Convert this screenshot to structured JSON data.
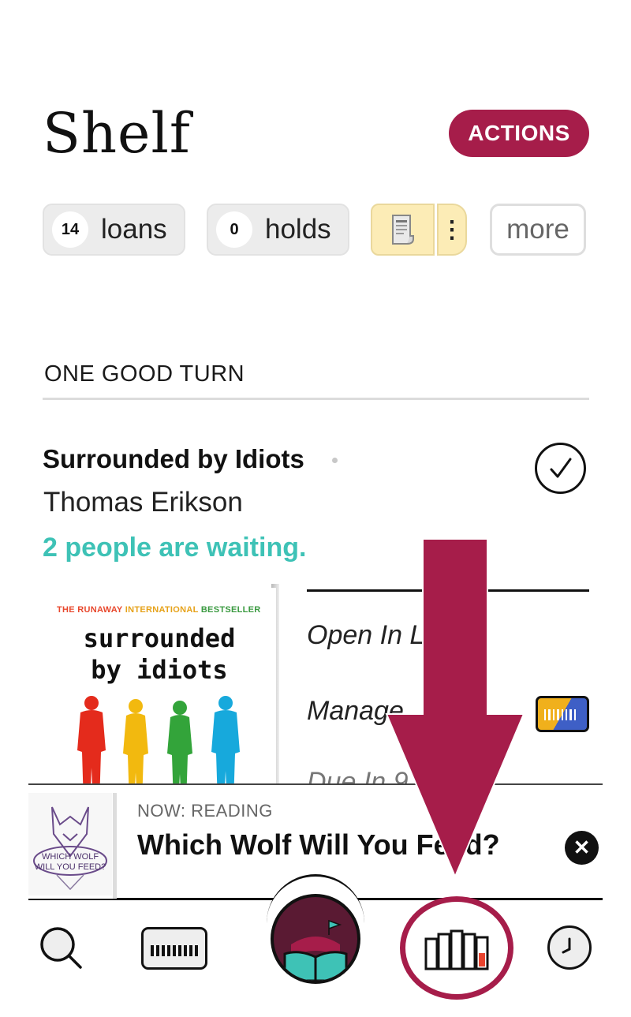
{
  "colors": {
    "accent": "#a61d4a",
    "teal": "#3ec2b6"
  },
  "header": {
    "title": "Shelf",
    "actions_label": "ACTIONS"
  },
  "chips": {
    "loans": {
      "count": "14",
      "label": "loans"
    },
    "holds": {
      "count": "0",
      "label": "holds"
    },
    "tag_icon": "receipt-icon",
    "more_label": "more"
  },
  "section": {
    "heading": "ONE GOOD TURN"
  },
  "book": {
    "title": "Surrounded by Idiots",
    "author": "Thomas Erikson",
    "status": "2 people are waiting.",
    "cover": {
      "tagline_1": "THE RUNAWAY",
      "tagline_2": "INTERNATIONAL",
      "tagline_3": "BESTSELLER",
      "title_line_1": "surrounded",
      "title_line_2": "by idiots"
    }
  },
  "book_menu": {
    "open_label": "Open In L",
    "manage_label": "Manage",
    "due_label": "Due In 9"
  },
  "now_reading": {
    "label": "NOW: READING",
    "title": "Which Wolf Will You Feed?",
    "cover_text_1": "WHICH WOLF",
    "cover_text_2": "WILL YOU FEED?"
  },
  "nav": {
    "search_icon": "search-icon",
    "card_icon": "library-card-icon",
    "home_icon": "open-book-icon",
    "shelf_icon": "bookshelf-icon",
    "timeline_icon": "clock-icon"
  }
}
